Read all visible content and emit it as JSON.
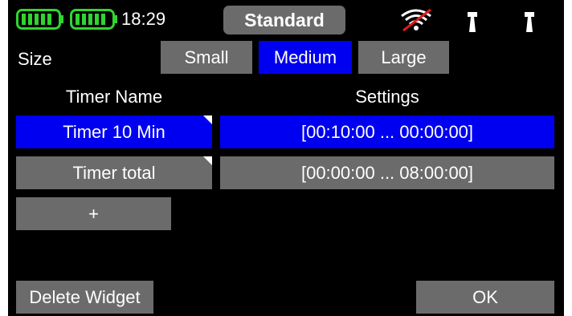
{
  "status_bar": {
    "battery_icon_1": "battery-full-icon",
    "battery_icon_2": "battery-full-icon",
    "time": "18:29",
    "profile": "Standard",
    "signal_icon": "wifi-off-icon",
    "antenna_icon_1": "antenna-icon",
    "antenna_icon_2": "antenna-icon",
    "battery_color": "#31d431",
    "signal_off_color": "#e01b1b"
  },
  "size": {
    "label": "Size",
    "options": [
      "Small",
      "Medium",
      "Large"
    ],
    "selected": "Medium"
  },
  "table": {
    "headers": [
      "Timer Name",
      "Settings"
    ],
    "rows": [
      {
        "name": "Timer 10 Min",
        "settings": "[00:10:00 ... 00:00:00]",
        "selected": true
      },
      {
        "name": "Timer total",
        "settings": "[00:00:00 ... 08:00:00]",
        "selected": false
      }
    ],
    "add_label": "+"
  },
  "footer": {
    "delete_label": "Delete Widget",
    "ok_label": "OK"
  },
  "colors": {
    "background": "#000000",
    "button": "#6b6b6b",
    "selected": "#0000f0",
    "text": "#ffffff"
  }
}
